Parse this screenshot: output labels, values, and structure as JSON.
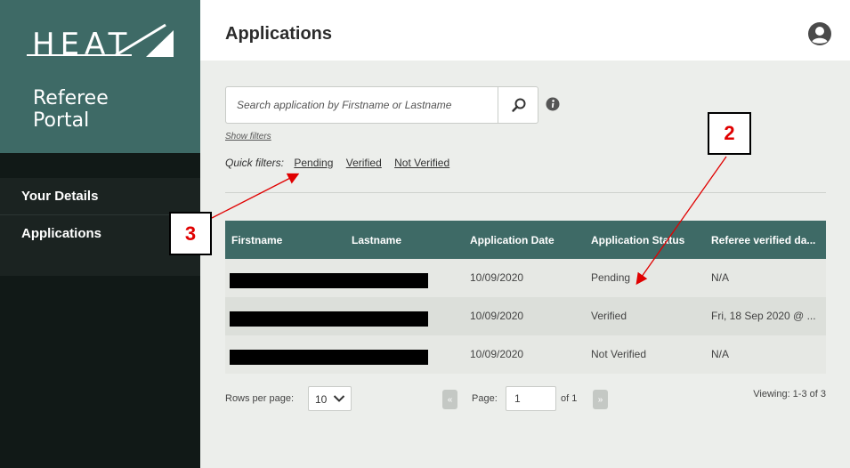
{
  "brand": {
    "logo": "HEAT",
    "portal_line1": "Referee",
    "portal_line2": "Portal"
  },
  "nav": {
    "items": [
      {
        "label": "Your Details"
      },
      {
        "label": "Applications"
      }
    ]
  },
  "header": {
    "title": "Applications"
  },
  "search": {
    "placeholder": "Search application by Firstname or Lastname",
    "value": ""
  },
  "filters": {
    "show_filters": "Show filters",
    "quick_label": "Quick filters:",
    "quick": [
      "Pending",
      "Verified",
      "Not Verified"
    ]
  },
  "table": {
    "columns": [
      "Firstname",
      "Lastname",
      "Application Date",
      "Application Status",
      "Referee verified da..."
    ],
    "rows": [
      {
        "date": "10/09/2020",
        "status": "Pending",
        "verified": "N/A"
      },
      {
        "date": "10/09/2020",
        "status": "Verified",
        "verified": "Fri, 18 Sep 2020 @ ..."
      },
      {
        "date": "10/09/2020",
        "status": "Not Verified",
        "verified": "N/A"
      }
    ]
  },
  "pager": {
    "rows_label": "Rows per page:",
    "rows_value": "10",
    "page_label": "Page:",
    "page_value": "1",
    "of_label": "of 1",
    "viewing": "Viewing: 1-3 of 3"
  },
  "annotations": {
    "callout_2": "2",
    "callout_3": "3"
  },
  "colors": {
    "brand_teal": "#3e6a66",
    "sidebar_dark": "#111917",
    "annotation_red": "#e00000"
  }
}
